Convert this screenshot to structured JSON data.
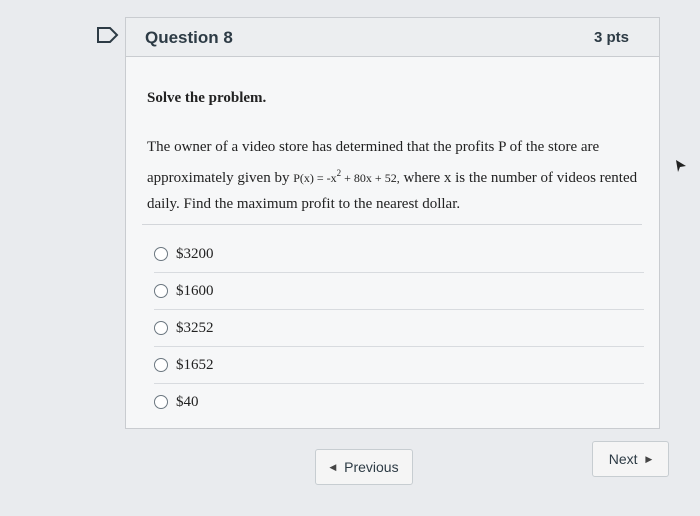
{
  "question": {
    "title": "Question 8",
    "points": "3 pts",
    "instructions": "Solve the problem.",
    "text_before": "The owner of a video store has determined that the profits P of the store are approximately given by",
    "formula": "P(x) = -x",
    "exponent": "2",
    "formula_rest": "+ 80x + 52,",
    "text_after": "where x is the number of videos rented daily. Find the maximum profit to the nearest dollar.",
    "answers": [
      "$3200",
      "$1600",
      "$3252",
      "$1652",
      "$40"
    ]
  },
  "nav": {
    "previous_label": "Previous",
    "next_label": "Next"
  }
}
